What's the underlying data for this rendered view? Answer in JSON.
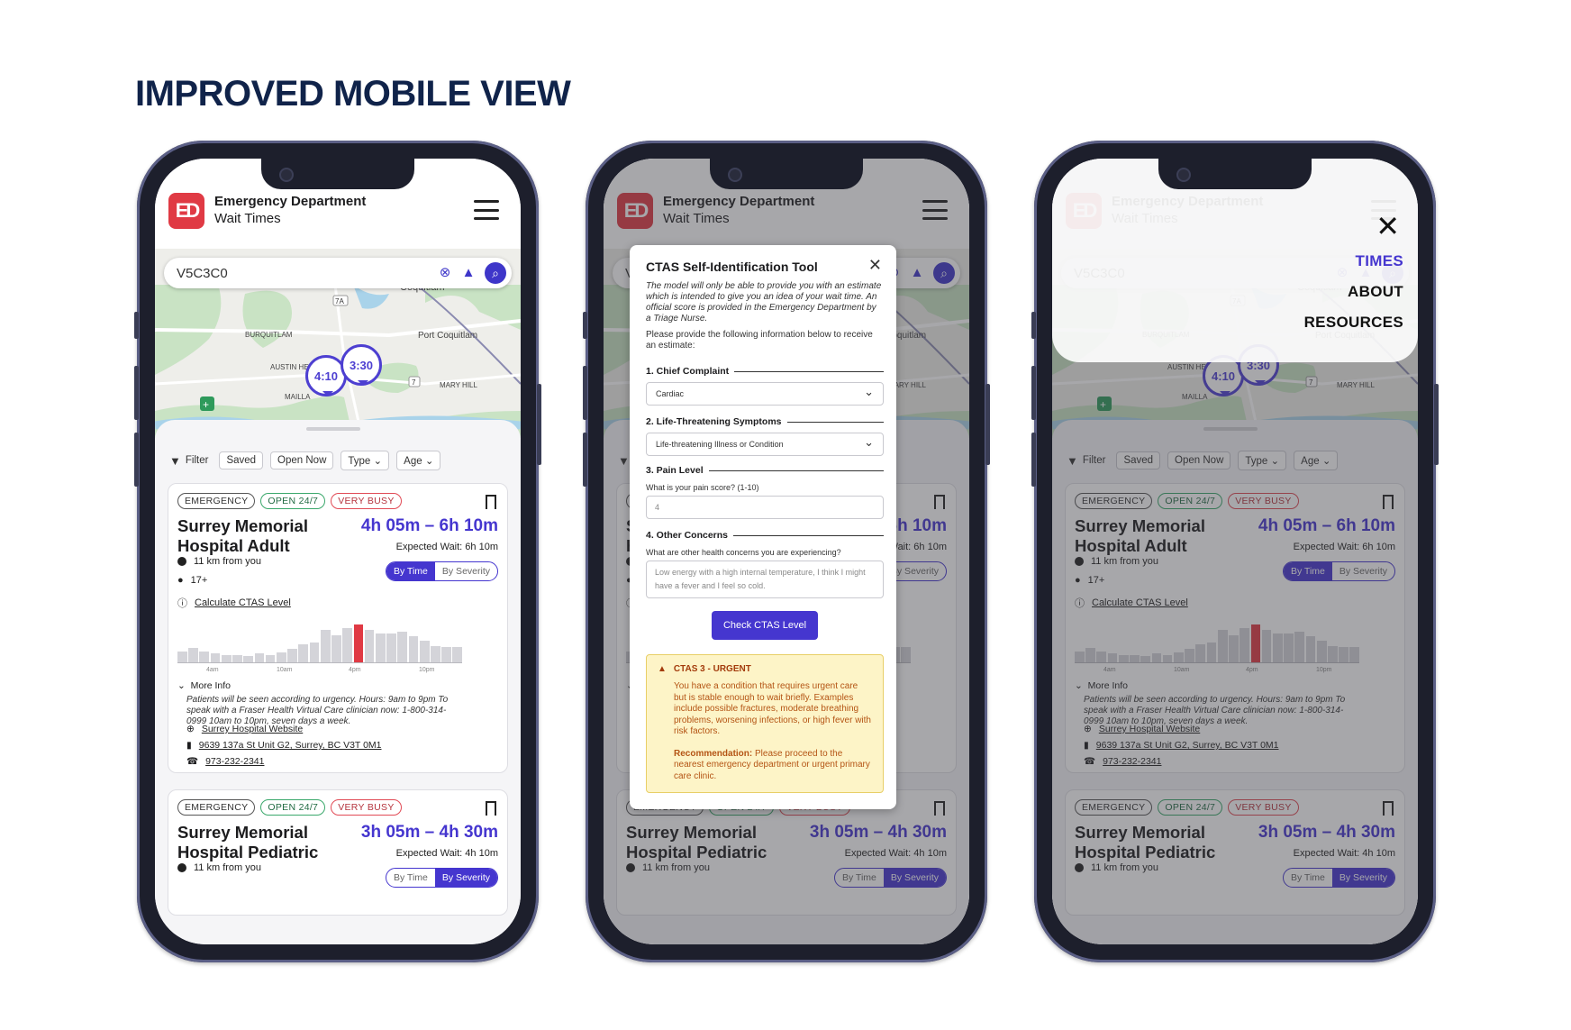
{
  "page_title": "IMPROVED MOBILE VIEW",
  "app": {
    "logo_text": "ED",
    "title_line1": "Emergency Department",
    "title_line2": "Wait Times"
  },
  "search": {
    "value": "V5C3C0"
  },
  "map": {
    "labels": [
      "Coquitlam",
      "BURQUITLAM",
      "Port Coquitlam",
      "AUSTIN HE",
      "MAILLA",
      "MARY HILL",
      "7A",
      "7"
    ],
    "pins": [
      "4:10",
      "3:30"
    ]
  },
  "filters": {
    "filter_label": "Filter",
    "saved": "Saved",
    "open_now": "Open Now",
    "type": "Type",
    "age": "Age"
  },
  "cards": [
    {
      "tags": [
        "EMERGENCY",
        "OPEN 24/7",
        "VERY BUSY"
      ],
      "name": "Surrey Memorial Hospital Adult",
      "wait_range": "4h 05m – 6h 10m",
      "expected": "Expected Wait: 6h 10m",
      "distance": "11 km from you",
      "age": "17+",
      "ctas_link": "Calculate CTAS Level",
      "sort_by_time": "By Time",
      "sort_by_severity": "By Severity",
      "sort_active": "time",
      "hourly_busyness": [
        12,
        16,
        12,
        10,
        8,
        8,
        7,
        10,
        8,
        11,
        15,
        20,
        22,
        36,
        30,
        38,
        42,
        36,
        32,
        32,
        34,
        29,
        24,
        18,
        17,
        17
      ],
      "current_hour_index": 16,
      "tick_labels": [
        "4am",
        "10am",
        "4pm",
        "10pm"
      ],
      "more_info": "More Info",
      "description": "Patients will be seen according to urgency. Hours: 9am to 9pm To speak with a Fraser Health Virtual Care clinician now: 1-800-314-0999 10am to 10pm, seven days a week.",
      "website": "Surrey Hospital Website",
      "address": "9639 137a St Unit G2, Surrey, BC V3T 0M1",
      "phone": "973-232-2341"
    },
    {
      "tags": [
        "EMERGENCY",
        "OPEN 24/7",
        "VERY BUSY"
      ],
      "name": "Surrey Memorial Hospital Pediatric",
      "wait_range": "3h 05m – 4h 30m",
      "expected": "Expected Wait: 4h 10m",
      "distance": "11 km from you",
      "sort_by_time": "By Time",
      "sort_by_severity": "By Severity",
      "sort_active": "severity"
    }
  ],
  "ctas_modal": {
    "title": "CTAS Self-Identification Tool",
    "intro": "The model will only be able to provide you with an estimate which is intended to give you an idea of your wait time. An official score is provided in the Emergency Department by a Triage Nurse.",
    "instruction": "Please provide the following information below to receive an estimate:",
    "s1": "1. Chief Complaint",
    "s1_value": "Cardiac",
    "s2": "2. Life-Threatening Symptoms",
    "s2_value": "Life-threatening Illness or Condition",
    "s3": "3. Pain Level",
    "s3_q": "What is your pain score? (1-10)",
    "s3_value": "4",
    "s4": "4. Other Concerns",
    "s4_q": "What are other health concerns you are experiencing?",
    "s4_placeholder": "Low energy with a high internal temperature, I think I might have a fever and I feel so cold.",
    "button": "Check CTAS Level",
    "result_title": "CTAS 3 - URGENT",
    "result_body": "You have a condition that requires urgent care but is stable enough to wait briefly. Examples include possible fractures, moderate breathing problems, worsening infections, or high fever with risk factors.",
    "recommendation_label": "Recommendation:",
    "recommendation": "Please proceed to the nearest emergency department or urgent primary care clinic."
  },
  "nav_menu": {
    "items": [
      "TIMES",
      "ABOUT",
      "RESOURCES"
    ],
    "active": "TIMES"
  },
  "colors": {
    "accent": "#4536cf",
    "brand_red": "#e03a44",
    "warning_bg": "#fdf4c7"
  }
}
